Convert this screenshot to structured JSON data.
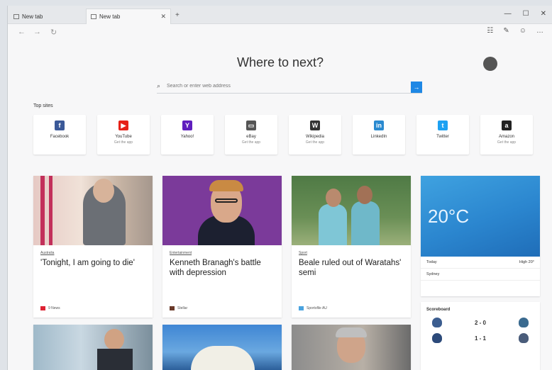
{
  "tabs": [
    {
      "title": "New tab",
      "active": false
    },
    {
      "title": "New tab",
      "active": true
    }
  ],
  "hero": {
    "title": "Where to next?",
    "search_placeholder": "Search or enter web address"
  },
  "top_sites": {
    "label": "Top sites",
    "items": [
      {
        "label": "Facebook",
        "sub": "",
        "icon": "facebook-icon",
        "color": "#3b5998",
        "glyph": "f"
      },
      {
        "label": "YouTube",
        "sub": "Get the app",
        "icon": "youtube-icon",
        "color": "#e62117",
        "glyph": "▶"
      },
      {
        "label": "Yahoo!",
        "sub": "",
        "icon": "yahoo-icon",
        "color": "#5f1ebe",
        "glyph": "Y"
      },
      {
        "label": "eBay",
        "sub": "Get the app",
        "icon": "ebay-icon",
        "color": "#555555",
        "glyph": "▭"
      },
      {
        "label": "Wikipedia",
        "sub": "Get the app",
        "icon": "wikipedia-icon",
        "color": "#333333",
        "glyph": "W"
      },
      {
        "label": "LinkedIn",
        "sub": "",
        "icon": "linkedin-icon",
        "color": "#2a8ad0",
        "glyph": "in"
      },
      {
        "label": "Twitter",
        "sub": "",
        "icon": "twitter-icon",
        "color": "#1da1f2",
        "glyph": "t"
      },
      {
        "label": "Amazon",
        "sub": "Get the app",
        "icon": "amazon-icon",
        "color": "#222222",
        "glyph": "a"
      }
    ]
  },
  "news": [
    {
      "category": "Australia",
      "headline": "'Tonight, I am going to die'",
      "source": "9 News",
      "source_color": "#d23"
    },
    {
      "category": "Entertainment",
      "headline": "Kenneth Branagh's battle with depression",
      "source": "Stellar",
      "source_color": "#6a3a2a"
    },
    {
      "category": "Sport",
      "headline": "Beale ruled out of Waratahs' semi",
      "source": "Sportsfile AU",
      "source_color": "#4aa3df"
    }
  ],
  "weather": {
    "temp": "20°C",
    "today_label": "Today",
    "today_value": "High 20°",
    "location": "Sydney"
  },
  "sports": {
    "title": "Scoreboard",
    "games": [
      {
        "score": "2 - 0"
      },
      {
        "score": "1 - 1"
      }
    ]
  }
}
